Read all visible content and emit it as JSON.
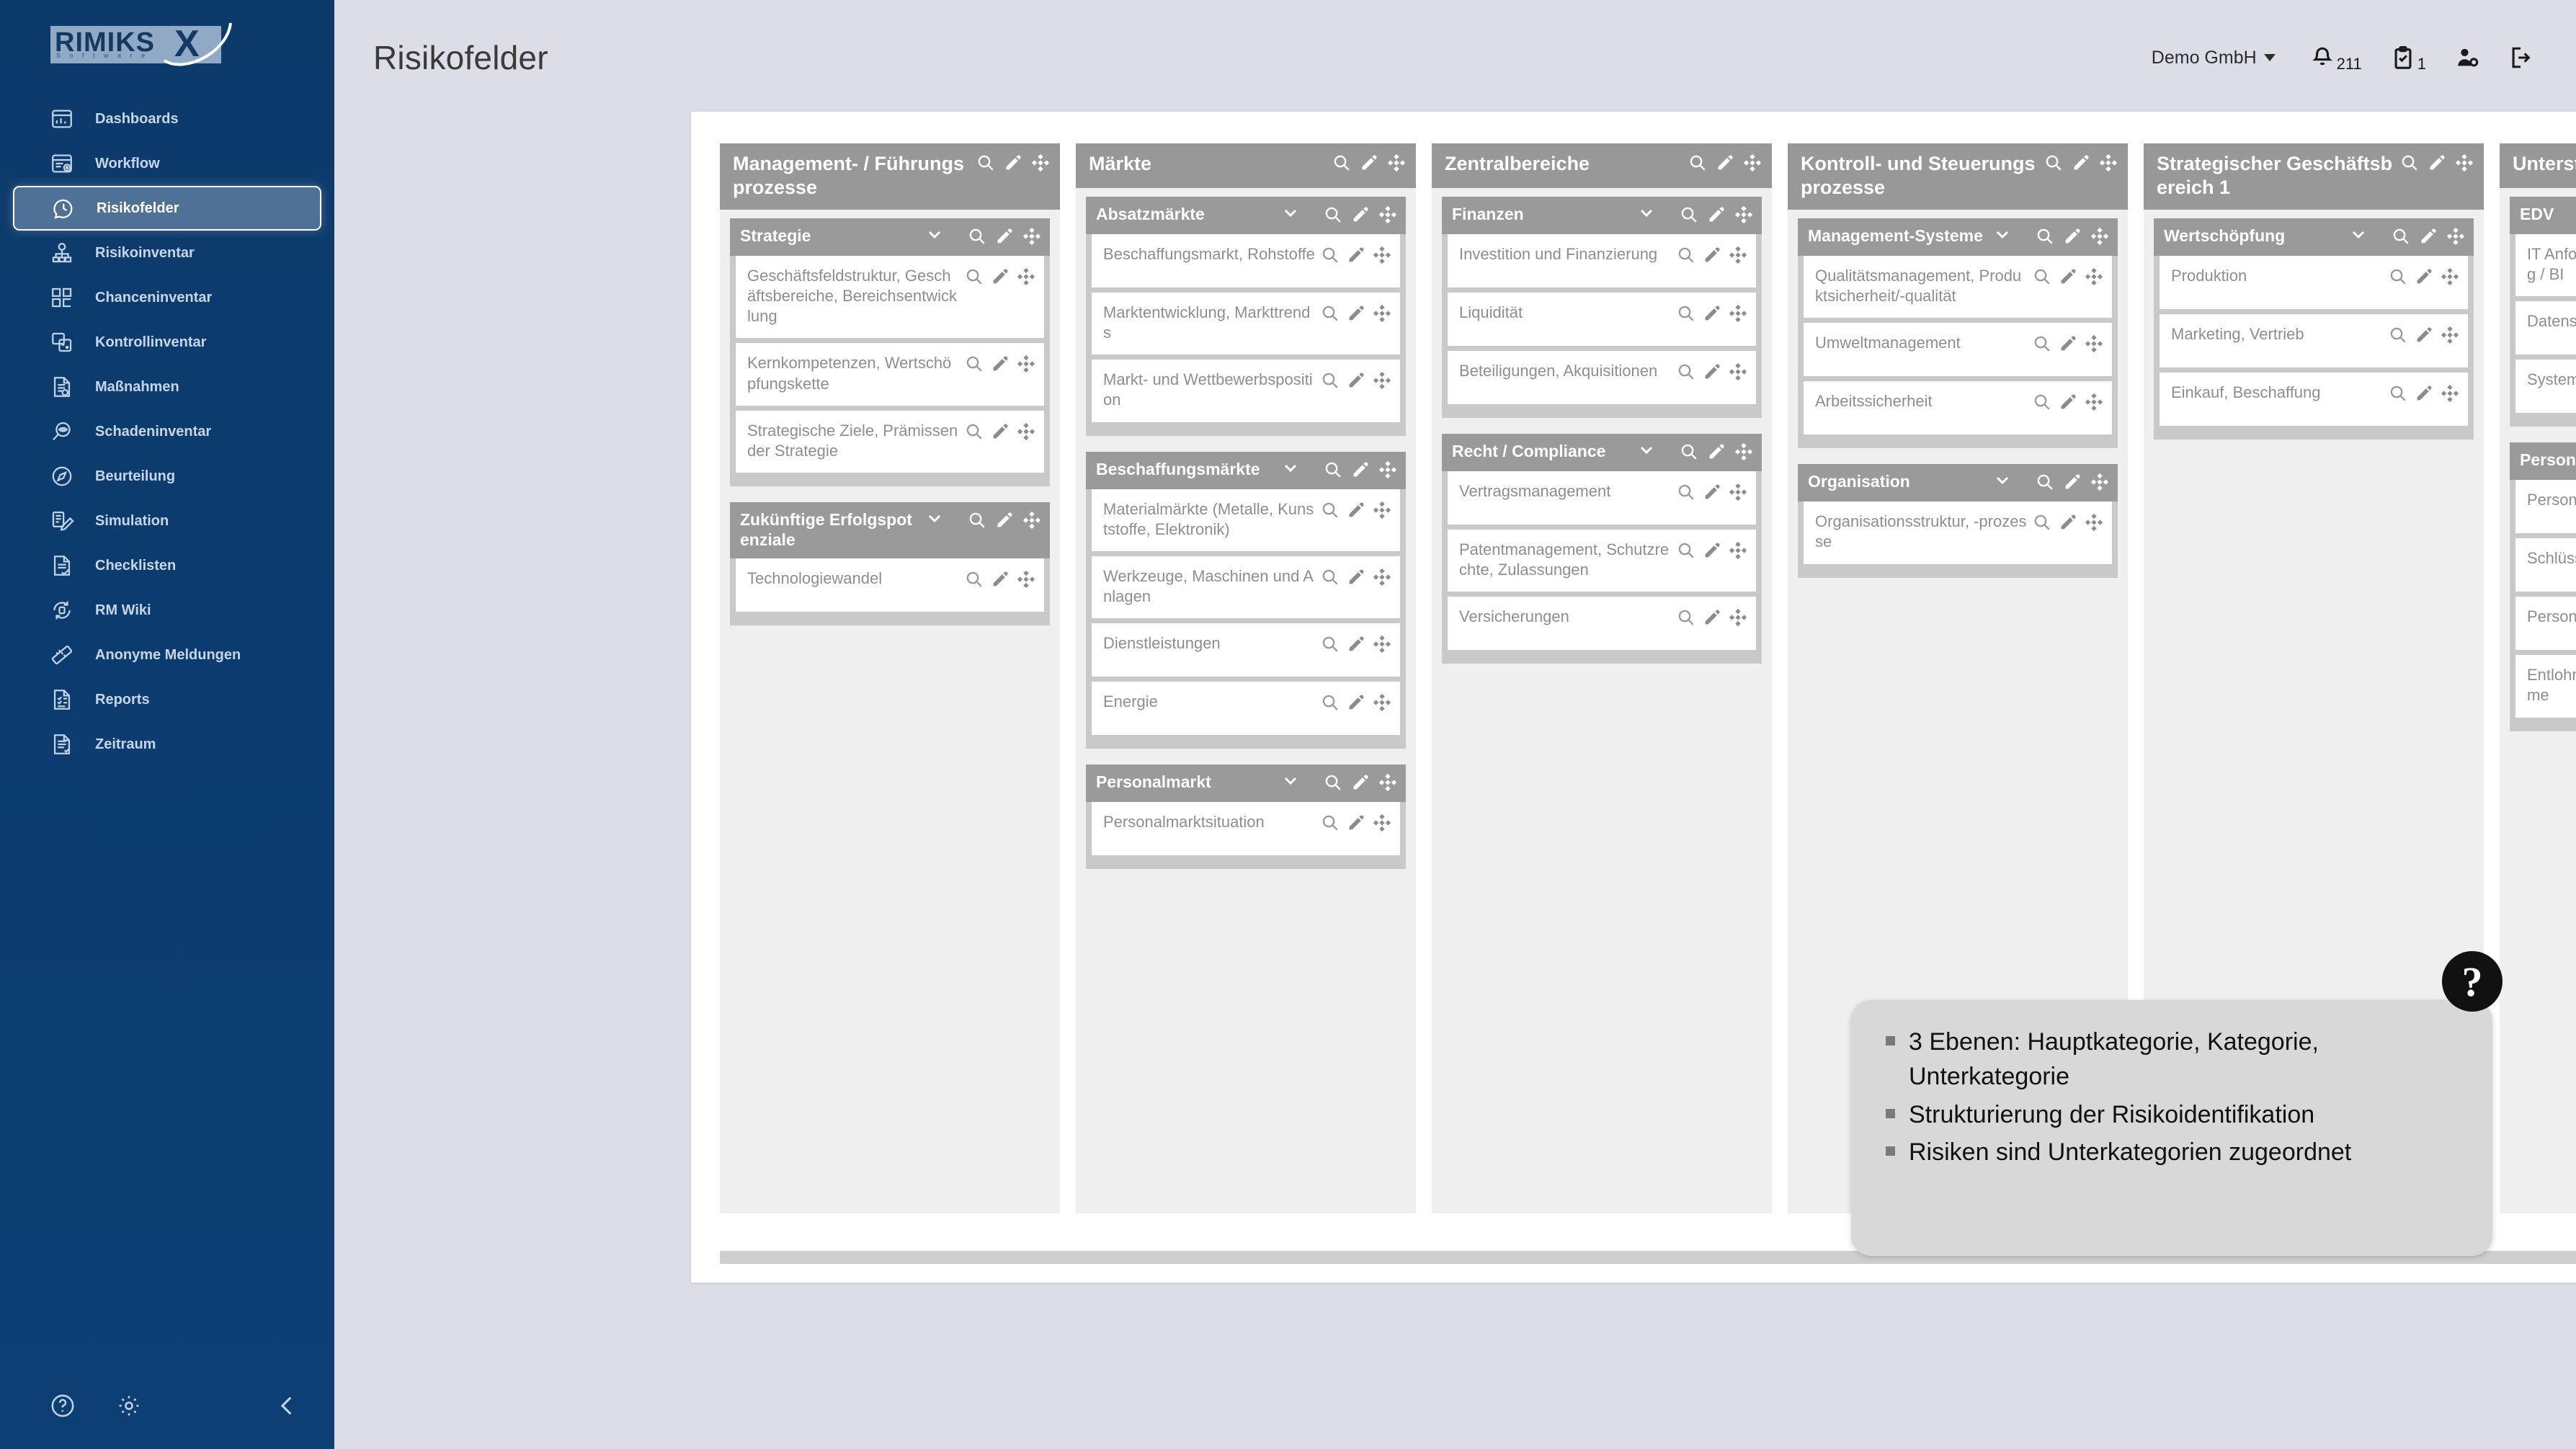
{
  "brand": {
    "name": "RIMIKS",
    "accent_letter": "X",
    "tagline": "S o f t w a r e"
  },
  "sidebar": {
    "items": [
      {
        "label": "Dashboards",
        "icon": "dashboard-icon",
        "active": false
      },
      {
        "label": "Workflow",
        "icon": "workflow-icon",
        "active": false
      },
      {
        "label": "Risikofelder",
        "icon": "risk-clock-icon",
        "active": true
      },
      {
        "label": "Risikoinventar",
        "icon": "risk-inventory-icon",
        "active": false
      },
      {
        "label": "Chanceninventar",
        "icon": "grid-icon",
        "active": false
      },
      {
        "label": "Kontrollinventar",
        "icon": "control-cards-icon",
        "active": false
      },
      {
        "label": "Maßnahmen",
        "icon": "measures-doc-icon",
        "active": false
      },
      {
        "label": "Schadeninventar",
        "icon": "eye-search-icon",
        "active": false
      },
      {
        "label": "Beurteilung",
        "icon": "compass-icon",
        "active": false
      },
      {
        "label": "Simulation",
        "icon": "simulation-edit-icon",
        "active": false
      },
      {
        "label": "Checklisten",
        "icon": "checklist-icon",
        "active": false
      },
      {
        "label": "RM Wiki",
        "icon": "wiki-refresh-icon",
        "active": false
      },
      {
        "label": "Anonyme Meldungen",
        "icon": "ruler-icon",
        "active": false
      },
      {
        "label": "Reports",
        "icon": "report-icon",
        "active": false
      },
      {
        "label": "Zeitraum",
        "icon": "timeframe-icon",
        "active": false
      }
    ],
    "footer": [
      {
        "icon": "help-circle-icon"
      },
      {
        "icon": "gear-icon"
      },
      {
        "icon": "collapse-chevron-icon"
      }
    ]
  },
  "header": {
    "title": "Risikofelder",
    "tenant": "Demo GmbH",
    "icons": [
      {
        "name": "notification-bell-icon",
        "badge": "211"
      },
      {
        "name": "tasks-clipboard-icon",
        "badge": "1"
      },
      {
        "name": "user-settings-icon",
        "badge": ""
      },
      {
        "name": "logout-icon",
        "badge": ""
      }
    ]
  },
  "row_icons": {
    "search": "search-icon",
    "edit": "pencil-icon",
    "move": "move-icon",
    "collapse": "chevron-down-icon"
  },
  "board": {
    "columns": [
      {
        "title": "Management- / Führungsprozesse",
        "groups": [
          {
            "title": "Strategie",
            "items": [
              "Geschäftsfeldstruktur, Geschäftsbereiche, Bereichsentwicklung",
              "Kernkompetenzen, Wertschöpfungskette",
              "Strategische Ziele, Prämissen der Strategie"
            ]
          },
          {
            "title": "Zukünftige Erfolgspotenziale",
            "items": [
              "Technologiewandel"
            ]
          }
        ]
      },
      {
        "title": "Märkte",
        "groups": [
          {
            "title": "Absatzmärkte",
            "items": [
              "Beschaffungsmarkt, Rohstoffe",
              "Marktentwicklung, Markttrends",
              "Markt- und Wettbewerbsposition"
            ]
          },
          {
            "title": "Beschaffungsmärkte",
            "items": [
              "Materialmärkte (Metalle, Kunststoffe, Elektronik)",
              "Werkzeuge, Maschinen und Anlagen",
              "Dienstleistungen",
              "Energie"
            ]
          },
          {
            "title": "Personalmarkt",
            "items": [
              "Personalmarktsituation"
            ]
          }
        ]
      },
      {
        "title": "Zentralbereiche",
        "groups": [
          {
            "title": "Finanzen",
            "items": [
              "Investition und Finanzierung",
              "Liquidität",
              "Beteiligungen, Akquisitionen"
            ]
          },
          {
            "title": "Recht / Compliance",
            "items": [
              "Vertragsmanagement",
              "Patentmanagement, Schutzrechte, Zulassungen",
              "Versicherungen"
            ]
          }
        ]
      },
      {
        "title": "Kontroll- und Steuerungsprozesse",
        "groups": [
          {
            "title": "Management-Systeme",
            "items": [
              "Qualitätsmanagement, Produktsicherheit/-qualität",
              "Umweltmanagement",
              "Arbeitssicherheit"
            ]
          },
          {
            "title": "Organisation",
            "items": [
              "Organisationsstruktur, -prozesse"
            ]
          }
        ]
      },
      {
        "title": "Strategischer Geschäftsbereich 1",
        "groups": [
          {
            "title": "Wertschöpfung",
            "items": [
              "Produktion",
              "Marketing, Vertrieb",
              "Einkauf, Beschaffung"
            ]
          }
        ]
      },
      {
        "title": "Unterstützungsprozesse",
        "groups": [
          {
            "title": "EDV",
            "items": [
              "IT Anforderungen / Auswertung / BI",
              "Datensicherheit",
              "Systemverfügbarkeit"
            ]
          },
          {
            "title": "Personal",
            "items": [
              "Personalbestand",
              "Schlüsselmitarbeiter",
              "Personalentwicklung",
              "Entlohnungs- und Anreizsysteme"
            ]
          }
        ]
      }
    ]
  },
  "tooltip": {
    "help_glyph": "?",
    "bullets": [
      "3 Ebenen: Hauptkategorie, Kategorie, Unterkategorie",
      "Strukturierung der Risikoidentifikation",
      "Risiken sind Unterkategorien zugeordnet"
    ]
  },
  "footer": {
    "save_icon": "save-floppy-icon",
    "save_color": "#5cb0ef"
  }
}
